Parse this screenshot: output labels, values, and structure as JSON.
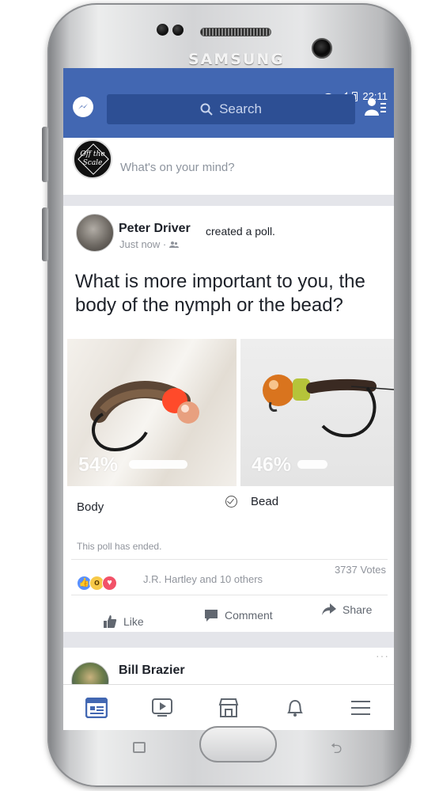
{
  "device": {
    "brand": "SAMSUNG"
  },
  "status_bar": {
    "time": "22:11"
  },
  "header": {
    "search_placeholder": "Search"
  },
  "composer": {
    "prompt": "What's on your mind?",
    "avatar_text_line1": "Off the",
    "avatar_text_line2": "Scale"
  },
  "post": {
    "author": "Peter Driver",
    "action": "created a poll.",
    "timestamp": "Just now ·",
    "question": "What is more important to you, the body of the nymph or the bead?",
    "options": [
      {
        "label": "Body",
        "percent_text": "54%",
        "percent": 54
      },
      {
        "label": "Bead",
        "percent_text": "46%",
        "percent": 46,
        "checked": true
      }
    ],
    "poll_status": "This poll has ended.",
    "reactions": [
      "like",
      "wow",
      "love"
    ],
    "reaction_names": "J.R. Hartley and 10 others",
    "votes": "3737 Votes",
    "actions": {
      "like": "Like",
      "comment": "Comment",
      "share": "Share"
    }
  },
  "next_post": {
    "author": "Bill Brazier",
    "more": "···"
  },
  "colors": {
    "facebook_blue": "#4267b2",
    "search_bg": "#2d4f94",
    "nav_active": "#4267b2"
  },
  "bottom_nav": [
    {
      "icon": "news-feed-icon",
      "active": true
    },
    {
      "icon": "video-icon"
    },
    {
      "icon": "marketplace-icon"
    },
    {
      "icon": "notifications-icon"
    },
    {
      "icon": "menu-icon"
    }
  ]
}
